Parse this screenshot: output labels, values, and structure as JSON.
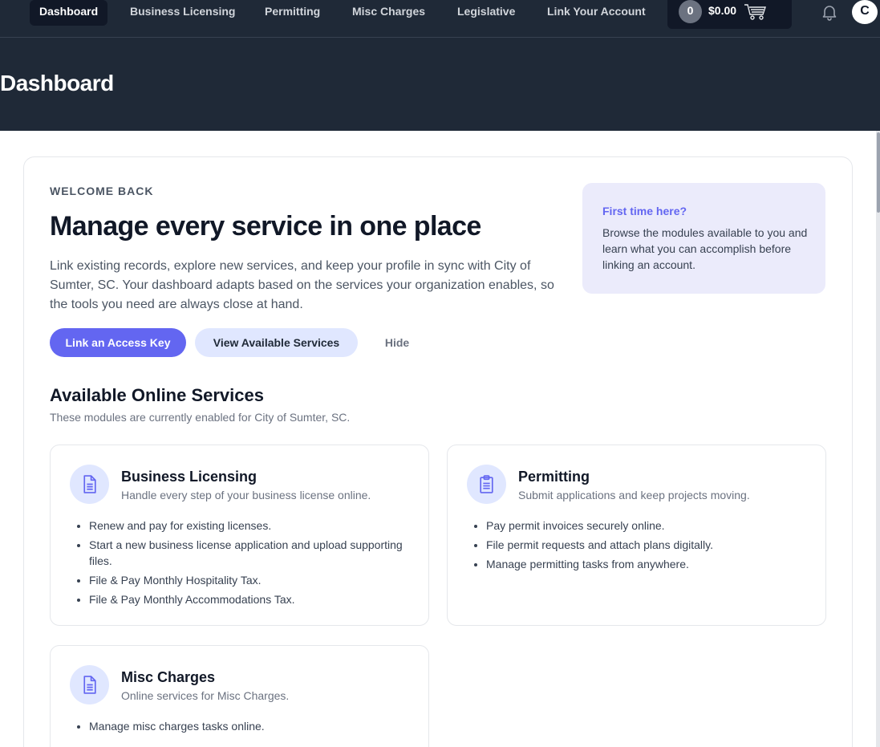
{
  "nav": {
    "items": [
      "Dashboard",
      "Business Licensing",
      "Permitting",
      "Misc Charges",
      "Legislative",
      "Link Your Account"
    ],
    "cart_count": "0",
    "cart_total": "$0.00",
    "avatar_initial": "C"
  },
  "page": {
    "title": "Dashboard"
  },
  "welcome": {
    "eyebrow": "WELCOME BACK",
    "headline": "Manage every service in one place",
    "body": "Link existing records, explore new services, and keep your profile in sync with City of Sumter, SC. Your dashboard adapts based on the services your organization enables, so the tools you need are always close at hand.",
    "primary_button": "Link an Access Key",
    "secondary_button": "View Available Services",
    "hide_button": "Hide"
  },
  "tip": {
    "title": "First time here?",
    "body": "Browse the modules available to you and learn what you can accomplish before linking an account."
  },
  "services": {
    "title": "Available Online Services",
    "subtitle": "These modules are currently enabled for City of Sumter, SC.",
    "cards": [
      {
        "icon": "document-icon",
        "name": "Business Licensing",
        "desc": "Handle every step of your business license online.",
        "bullets": [
          "Renew and pay for existing licenses.",
          "Start a new business license application and upload supporting files.",
          "File & Pay Monthly Hospitality Tax.",
          "File & Pay Monthly Accommodations Tax."
        ]
      },
      {
        "icon": "clipboard-icon",
        "name": "Permitting",
        "desc": "Submit applications and keep projects moving.",
        "bullets": [
          "Pay permit invoices securely online.",
          "File permit requests and attach plans digitally.",
          "Manage permitting tasks from anywhere."
        ]
      },
      {
        "icon": "document-icon",
        "name": "Misc Charges",
        "desc": "Online services for Misc Charges.",
        "bullets": [
          "Manage misc charges tasks online."
        ]
      }
    ]
  },
  "colors": {
    "accent": "#6366f1",
    "header_bg": "#1f2937",
    "tip_bg": "#ebebfb"
  }
}
